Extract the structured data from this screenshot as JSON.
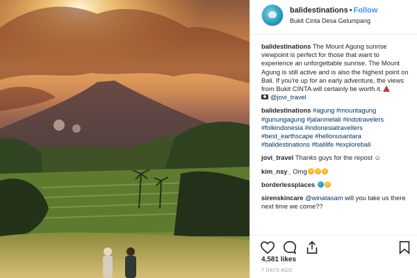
{
  "post": {
    "username": "balidestinations",
    "separator": "•",
    "follow_label": "Follow",
    "location": "Bukit Cinta Desa Gelumpang",
    "caption": {
      "username": "balidestinations",
      "text": "The Mount Agung sunrise viewpoint is perfect for those that want to experience an unforgettable sunrise. The Mount Agung is still active and is also the highest point on Bali. If you're up for an early adventure, the views from Bukit CINTA will certainly be worth it.",
      "volcano_icon": "volcano-emoji",
      "camera_icon": "camera-emoji",
      "credit": "@jovi_travel"
    },
    "hashtag_comment": {
      "username": "balidestinations",
      "tags": "#agung #mountagung #gunungagung #jalanmelali #indotravelers #folkindonesia #indonesiatravellers #best_earthscape #hellonusantara #balidestinations #balilife #explorebali"
    },
    "comments": [
      {
        "username": "jovi_travel",
        "text": "Thanks guys for the repost ☺"
      },
      {
        "username": "kim_nsy_",
        "text": "Omg",
        "emoji": [
          "laughing-emoji",
          "laughing-emoji",
          "laughing-emoji"
        ]
      },
      {
        "username": "borderlessplaces",
        "text": "",
        "emoji": [
          "earth-emoji",
          "laughing-emoji"
        ]
      },
      {
        "username": "sirenskincare",
        "mention": "@winatasam",
        "text": "will you take us there next time we come??"
      }
    ],
    "likes": "4,581 likes",
    "time_ago": "7 DAYS AGO"
  },
  "icons": {
    "like": "heart-icon",
    "comment": "comment-icon",
    "share": "share-icon",
    "save": "bookmark-icon"
  },
  "colors": {
    "follow_blue": "#3897f0",
    "link": "#003569",
    "muted": "#999999",
    "border": "#efefef"
  }
}
